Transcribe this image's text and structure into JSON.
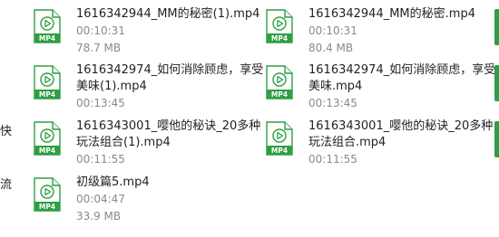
{
  "left_snippets": [
    "快",
    "流"
  ],
  "file_type_badge": "MP4",
  "colors": {
    "icon_green": "#2f9e44",
    "badge_text": "#ffffff",
    "meta_text": "#8a8a8a"
  },
  "files": [
    {
      "name_lines": [
        "1616342944_MM的秘密(1).mp4"
      ],
      "duration": "00:10:31",
      "size": "78.7 MB"
    },
    {
      "name_lines": [
        "1616342944_MM的秘密.mp4"
      ],
      "duration": "00:10:31",
      "size": "80.4 MB"
    },
    {
      "name_lines": [
        "1616342974_如何消除顾虑，享受",
        "美味(1).mp4"
      ],
      "duration": "00:13:45"
    },
    {
      "name_lines": [
        "1616342974_如何消除顾虑，享受",
        "美味.mp4"
      ],
      "duration": "00:13:45"
    },
    {
      "name_lines": [
        "1616343001_嘤他的秘诀_20多种",
        "玩法组合(1).mp4"
      ],
      "duration": "00:11:55"
    },
    {
      "name_lines": [
        "1616343001_嘤他的秘诀_20多种",
        "玩法组合.mp4"
      ],
      "duration": "00:11:55"
    },
    {
      "name_lines": [
        "初级篇5.mp4"
      ],
      "duration": "00:04:47",
      "size": "33.9 MB"
    }
  ]
}
